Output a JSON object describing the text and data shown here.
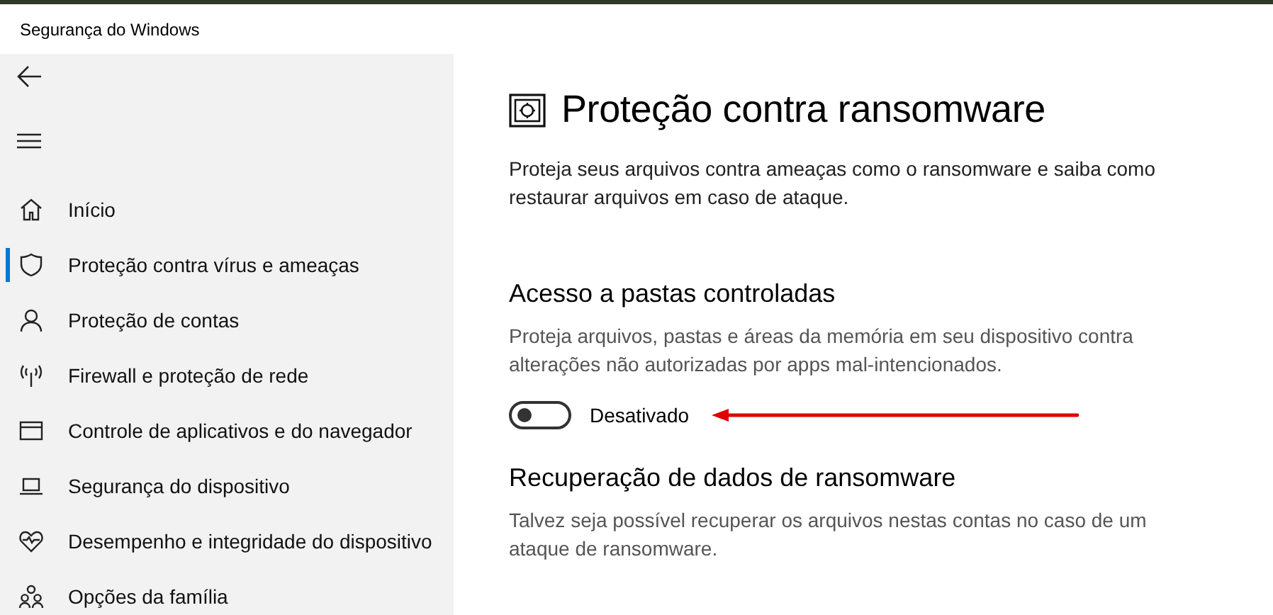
{
  "window": {
    "title": "Segurança do Windows"
  },
  "sidebar": {
    "items": [
      {
        "label": "Início",
        "kind": "home",
        "selected": false
      },
      {
        "label": "Proteção contra vírus e ameaças",
        "kind": "shield",
        "selected": true
      },
      {
        "label": "Proteção de contas",
        "kind": "person",
        "selected": false
      },
      {
        "label": "Firewall e proteção de rede",
        "kind": "antenna",
        "selected": false
      },
      {
        "label": "Controle de aplicativos e do navegador",
        "kind": "window",
        "selected": false
      },
      {
        "label": "Segurança do dispositivo",
        "kind": "laptop",
        "selected": false
      },
      {
        "label": "Desempenho e integridade do dispositivo",
        "kind": "heart",
        "selected": false
      },
      {
        "label": "Opções da família",
        "kind": "family",
        "selected": false
      }
    ]
  },
  "page": {
    "title": "Proteção contra ransomware",
    "description": "Proteja seus arquivos contra ameaças como o ransomware e saiba como restaurar arquivos em caso de ataque."
  },
  "sections": [
    {
      "heading": "Acesso a pastas controladas",
      "description": "Proteja arquivos, pastas e áreas da memória em seu dispositivo contra alterações não autorizadas por apps mal-intencionados.",
      "toggle": {
        "on": false,
        "label": "Desativado"
      }
    },
    {
      "heading": "Recuperação de dados de ransomware",
      "description": "Talvez seja possível recuperar os arquivos nestas contas no caso de um ataque de ransomware."
    }
  ]
}
